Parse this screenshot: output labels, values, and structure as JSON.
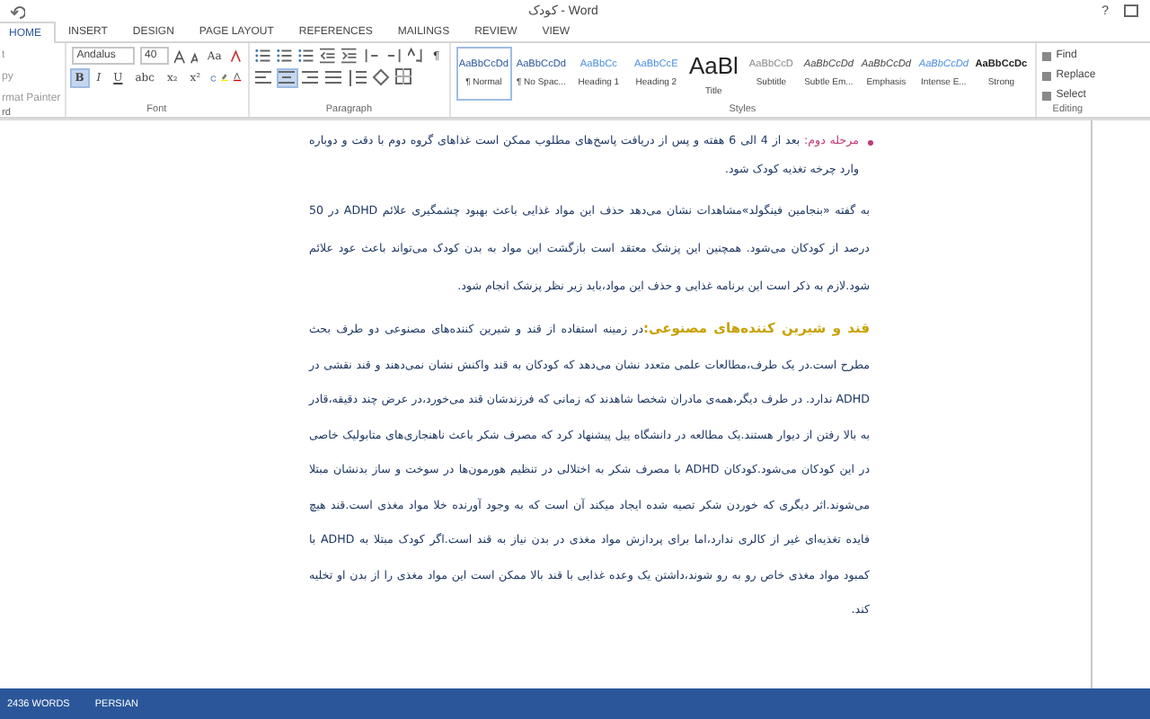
{
  "window": {
    "title": "کودک - Word",
    "help": "?"
  },
  "tabs": [
    {
      "label": "HOME",
      "selected": true
    },
    {
      "label": "INSERT",
      "selected": false
    },
    {
      "label": "DESIGN",
      "selected": false
    },
    {
      "label": "PAGE LAYOUT",
      "selected": false
    },
    {
      "label": "REFERENCES",
      "selected": false
    },
    {
      "label": "MAILINGS",
      "selected": false
    },
    {
      "label": "REVIEW",
      "selected": false
    },
    {
      "label": "VIEW",
      "selected": false
    }
  ],
  "clipboard": {
    "items": [
      "t",
      "py",
      "rmat Painter"
    ],
    "label": "rd"
  },
  "font": {
    "name": "Andalus",
    "size": "40",
    "case": "Aa",
    "buttons": [
      {
        "label": "B",
        "on": true
      },
      {
        "label": "I",
        "on": false
      },
      {
        "label": "U",
        "on": false
      },
      {
        "label": "abc",
        "on": false
      },
      {
        "label": "x₂",
        "on": false
      },
      {
        "label": "x²",
        "on": false
      }
    ],
    "label": "Font"
  },
  "paragraph": {
    "buttons": [
      {
        "on": false
      },
      {
        "on": true
      },
      {
        "on": false
      },
      {
        "on": false
      }
    ],
    "mark": "¶",
    "label": "Paragraph"
  },
  "styles": {
    "items": [
      {
        "preview": "AaBbCcDd",
        "name": "¶ Normal",
        "selected": true
      },
      {
        "preview": "AaBbCcDd",
        "name": "¶ No Spac...",
        "selected": false
      },
      {
        "preview": "AaBbCc",
        "name": "Heading 1",
        "selected": false
      },
      {
        "preview": "AaBbCcE",
        "name": "Heading 2",
        "selected": false
      },
      {
        "preview": "AaBl",
        "name": "Title",
        "selected": false
      },
      {
        "preview": "AaBbCcD",
        "name": "Subtitle",
        "selected": false
      },
      {
        "preview": "AaBbCcDd",
        "name": "Subtle Em...",
        "selected": false
      },
      {
        "preview": "AaBbCcDd",
        "name": "Emphasis",
        "selected": false
      },
      {
        "preview": "AaBbCcDd",
        "name": "Intense E...",
        "selected": false
      },
      {
        "preview": "AaBbCcDc",
        "name": "Strong",
        "selected": false
      }
    ],
    "label": "Styles"
  },
  "editing": {
    "items": [
      "Find",
      "Replace",
      "Select"
    ],
    "label": "Editing"
  },
  "document": {
    "paragraphs": [
      {
        "kind": "bullet",
        "lead": "مرحله دوم:",
        "text": " بعد از 4 الی 6 هفته و پس از دریافت پاسخ‌های مطلوب ممکن است غذاهای گروه دوم با دقت و دوباره وارد چرخه تغذیه کودک شود."
      },
      {
        "kind": "plain",
        "text": "به گفته «بنجامین فینگولد»مشاهدات نشان می‌دهد حذف این مواد غذایی باعث بهبود چشمگیری علائم ADHD در 50 درصد از کودکان می‌شود. همچنین این پزشک معتقد است بازگشت این مواد به بدن کودک می‌تواند باعث عود علائم شود.لازم به ذکر است این برنامه غذایی و حذف این مواد،باید زیر نظر پزشک انجام شود."
      },
      {
        "kind": "heading",
        "lead": "قند و شیرین کننده‌های مصنوعی:",
        "text": "در زمینه استفاده از قند و شیرین کننده‌های مصنوعی دو طرف بحث مطرح است.در یک طرف،مطالعات علمی متعدد نشان می‌دهد که کودکان به قند واکنش نشان نمی‌دهند و قند نقشی در ADHD ندارد. در طرف دیگر،همه‌ی مادران شخصا شاهدند که زمانی که فرزندشان قند می‌خورد،در عرض چند دقیقه،قادر به بالا رفتن از دیوار هستند.یک مطالعه در دانشگاه ییل پیشنهاد کرد که مصرف شکر باعث ناهنجاری‌های متابولیک خاصی در این کودکان می‌شود.کودکان ADHD با مصرف شکر به اختلالی در تنظیم هورمون‌ها در سوخت و ساز بدنشان مبتلا می‌شوند.اثر دیگری که خوردن شکر تصیه شده ایجاد میکند آن است که به وجود آورنده خلا مواد مغذی است.قند هیچ فایده تغذیه‌ای غیر از کالری ندارد،اما برای پردازش مواد مغذی در بدن نیاز به قند است.اگر کودک مبتلا به ADHD با کمبود مواد مغذی خاص رو به رو شوند،داشتن یک وعده غذایی با قند بالا ممکن است این مواد مغذی را از بدن او تخلیه کند."
      }
    ]
  },
  "status_bar": {
    "items": [
      "2436 WORDS",
      "PERSIAN"
    ]
  }
}
